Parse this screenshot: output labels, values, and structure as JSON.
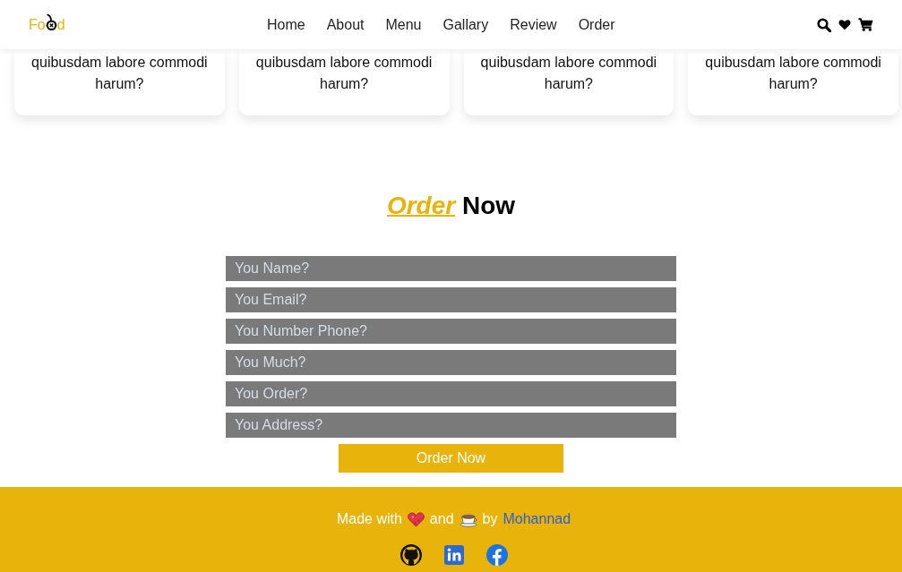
{
  "header": {
    "logo": {
      "before": "Fo",
      "after": "d"
    },
    "nav": [
      "Home",
      "About",
      "Menu",
      "Gallary",
      "Review",
      "Order"
    ]
  },
  "cards": [
    {
      "text": "quibusdam labore commodi harum?"
    },
    {
      "text": "quibusdam labore commodi harum?"
    },
    {
      "text": "quibusdam labore commodi harum?"
    },
    {
      "text": "quibusdam labore commodi harum?"
    }
  ],
  "order": {
    "title": "*Order* Now",
    "fields": [
      {
        "placeholder": "You Name?"
      },
      {
        "placeholder": "You Email?"
      },
      {
        "placeholder": "You Number Phone?"
      },
      {
        "placeholder": "You Much?"
      },
      {
        "placeholder": "You Order?"
      },
      {
        "placeholder": "You Address?"
      }
    ],
    "submit": "Order Now"
  },
  "footer": {
    "credit": {
      "lead": "Made with",
      "middle": "and",
      "by": "by",
      "author": "Mohannad"
    }
  }
}
